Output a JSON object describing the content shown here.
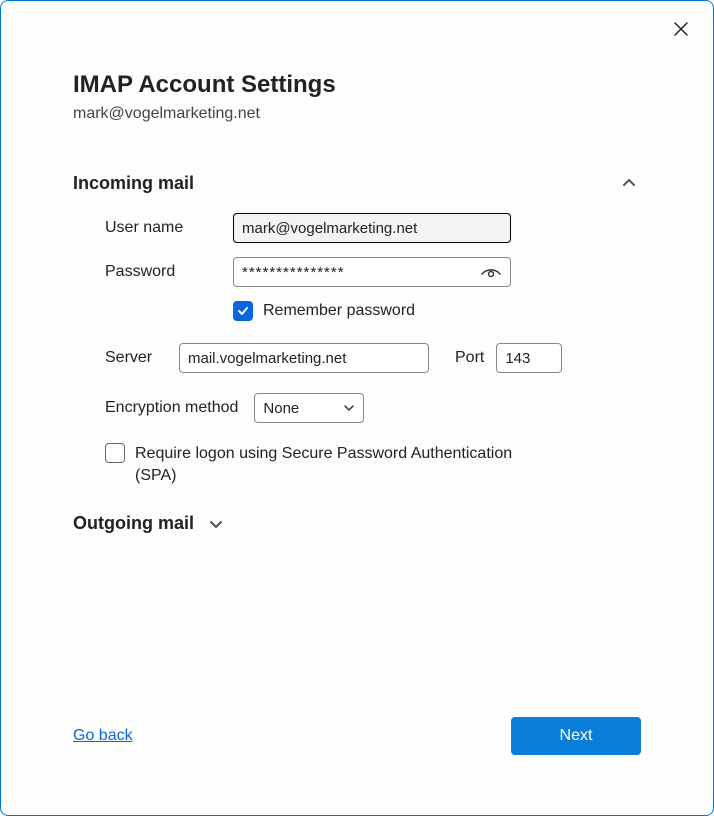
{
  "title": "IMAP Account Settings",
  "email": "mark@vogelmarketing.net",
  "sections": {
    "incoming": {
      "title": "Incoming mail",
      "expanded": true,
      "username_label": "User name",
      "username_value": "mark@vogelmarketing.net",
      "password_label": "Password",
      "password_value": "***************",
      "remember_label": "Remember password",
      "remember_checked": true,
      "server_label": "Server",
      "server_value": "mail.vogelmarketing.net",
      "port_label": "Port",
      "port_value": "143",
      "encryption_label": "Encryption method",
      "encryption_value": "None",
      "spa_label": "Require logon using Secure Password Authentication (SPA)",
      "spa_checked": false
    },
    "outgoing": {
      "title": "Outgoing mail",
      "expanded": false
    }
  },
  "footer": {
    "back_label": "Go back",
    "next_label": "Next"
  }
}
